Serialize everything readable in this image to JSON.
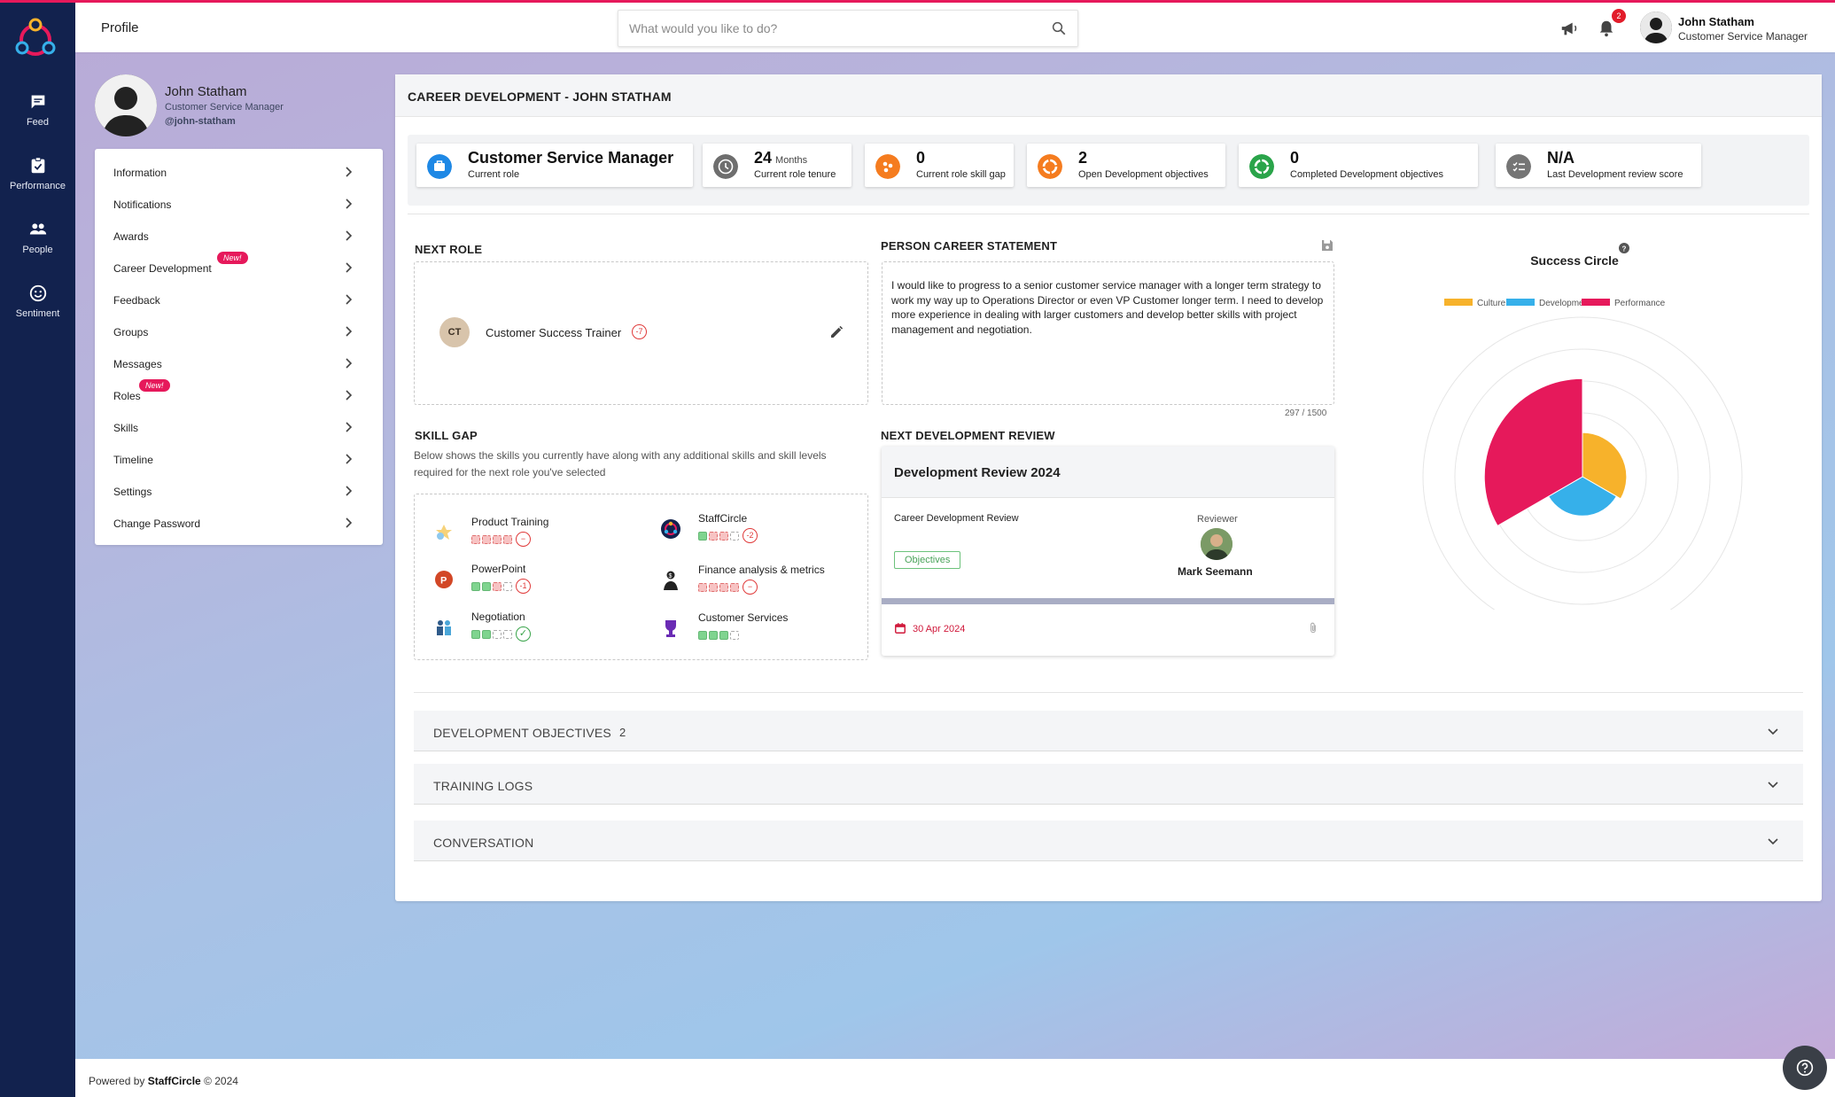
{
  "colors": {
    "accent": "#e6195b",
    "nav_bg": "#12224e",
    "culture": "#f7b22b",
    "development": "#36b0ea",
    "performance": "#e6195b"
  },
  "nav": {
    "items": [
      {
        "label": "Feed",
        "icon": "feed-icon"
      },
      {
        "label": "Performance",
        "icon": "clipboard-check-icon"
      },
      {
        "label": "People",
        "icon": "people-icon"
      },
      {
        "label": "Sentiment",
        "icon": "smiley-icon"
      }
    ]
  },
  "header": {
    "title": "Profile",
    "search_placeholder": "What would you like to do?",
    "notification_count": "2",
    "user_name": "John Statham",
    "user_role": "Customer Service Manager"
  },
  "profile": {
    "name": "John Statham",
    "role": "Customer Service Manager",
    "handle": "@john-statham"
  },
  "menu": {
    "new_label": "New!",
    "items": [
      "Information",
      "Notifications",
      "Awards",
      "Career Development",
      "Feedback",
      "Groups",
      "Messages",
      "Roles",
      "Skills",
      "Timeline",
      "Settings",
      "Change Password"
    ]
  },
  "main": {
    "title": "CAREER DEVELOPMENT - JOHN STATHAM",
    "stats": [
      {
        "value": "Customer Service Manager",
        "label": "Current role",
        "icon": "briefcase-icon"
      },
      {
        "value": "24",
        "unit": "Months",
        "label": "Current role tenure",
        "icon": "clock-icon"
      },
      {
        "value": "0",
        "label": "Current role skill gap",
        "icon": "skills-icon"
      },
      {
        "value": "2",
        "label": "Open Development objectives",
        "icon": "target-icon"
      },
      {
        "value": "0",
        "label": "Completed Development objectives",
        "icon": "cycle-icon"
      },
      {
        "value": "N/A",
        "label": "Last Development review score",
        "icon": "checklist-icon"
      }
    ],
    "next_role": {
      "title": "NEXT ROLE",
      "initials": "CT",
      "role": "Customer Success Trainer",
      "gap": "-7"
    },
    "statement": {
      "title": "PERSON CAREER STATEMENT",
      "text": "I would like to progress to a senior customer service manager with a longer term strategy to work my way up to Operations Director or even VP Customer longer term. I need to develop more experience in dealing with larger customers and develop better skills with project management and negotiation.",
      "counter": "297 / 1500"
    },
    "skill_gap": {
      "title": "SKILL GAP",
      "description": "Below shows the skills you currently have along with any additional skills and skill levels required for the next role you've selected",
      "skills": [
        {
          "name": "Product Training",
          "gap": "−",
          "levels": [
            "r",
            "r",
            "r",
            "r"
          ],
          "icon": "product-training-icon"
        },
        {
          "name": "PowerPoint",
          "gap": "-1",
          "levels": [
            "g",
            "g",
            "r",
            "e"
          ],
          "icon": "powerpoint-icon"
        },
        {
          "name": "Negotiation",
          "gap": "✓",
          "levels": [
            "g",
            "g",
            "e",
            "e"
          ],
          "icon": "negotiation-icon"
        },
        {
          "name": "StaffCircle",
          "gap": "-2",
          "levels": [
            "g",
            "r",
            "r",
            "e"
          ],
          "icon": "staffcircle-icon"
        },
        {
          "name": "Finance analysis & metrics",
          "gap": "−",
          "levels": [
            "r",
            "r",
            "r",
            "r"
          ],
          "icon": "finance-icon"
        },
        {
          "name": "Customer Services",
          "gap": "",
          "levels": [
            "g",
            "g",
            "g",
            "e"
          ],
          "icon": "trophy-icon"
        }
      ]
    },
    "review": {
      "title": "NEXT DEVELOPMENT REVIEW",
      "card_title": "Development Review 2024",
      "subtitle": "Career Development Review",
      "objectives_label": "Objectives",
      "reviewer_label": "Reviewer",
      "reviewer_name": "Mark Seemann",
      "date": "30 Apr 2024"
    },
    "accordions": [
      {
        "label": "DEVELOPMENT OBJECTIVES",
        "count": "2"
      },
      {
        "label": "TRAINING LOGS",
        "count": ""
      },
      {
        "label": "CONVERSATION",
        "count": ""
      }
    ]
  },
  "chart_data": {
    "type": "polar-area",
    "title": "Success Circle",
    "legend": [
      "Culture",
      "Development",
      "Performance"
    ],
    "legend_placement": "top",
    "colors": [
      "#f7b22b",
      "#36b0ea",
      "#e6195b"
    ],
    "values": [
      1.8,
      1.6,
      4.0
    ],
    "rings": 5,
    "rmax": 6.5
  },
  "footer": {
    "prefix": "Powered by ",
    "brand": "StaffCircle",
    "suffix": " © 2024"
  }
}
